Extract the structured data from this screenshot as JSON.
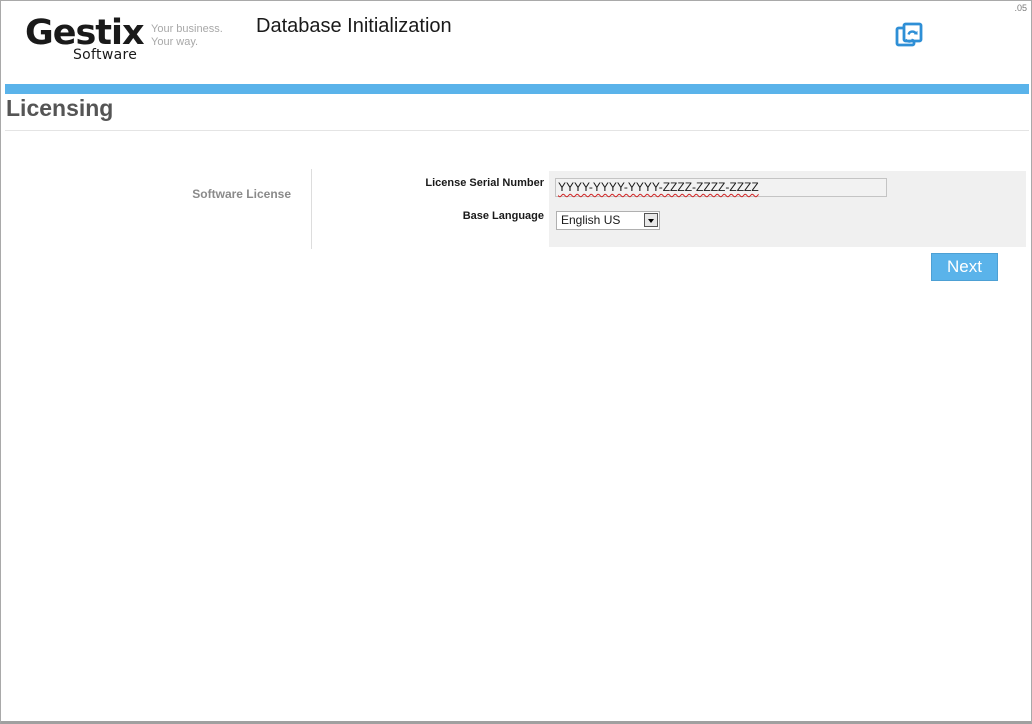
{
  "window": {
    "version": ".05"
  },
  "logo": {
    "brand": "Gestix",
    "sub": "Software",
    "tagline_line1": "Your business.",
    "tagline_line2": "Your way."
  },
  "header": {
    "title": "Database Initialization",
    "refresh_icon": "refresh-icon"
  },
  "section": {
    "title": "Licensing",
    "group_label": "Software License"
  },
  "form": {
    "serial_label": "License Serial Number",
    "serial_value": "YYYY-YYYY-YYYY-ZZZZ-ZZZZ-ZZZZ",
    "language_label": "Base Language",
    "language_value": "English US"
  },
  "actions": {
    "next_label": "Next"
  },
  "colors": {
    "accent": "#5ab3ea",
    "panel": "#f0f0f0"
  }
}
